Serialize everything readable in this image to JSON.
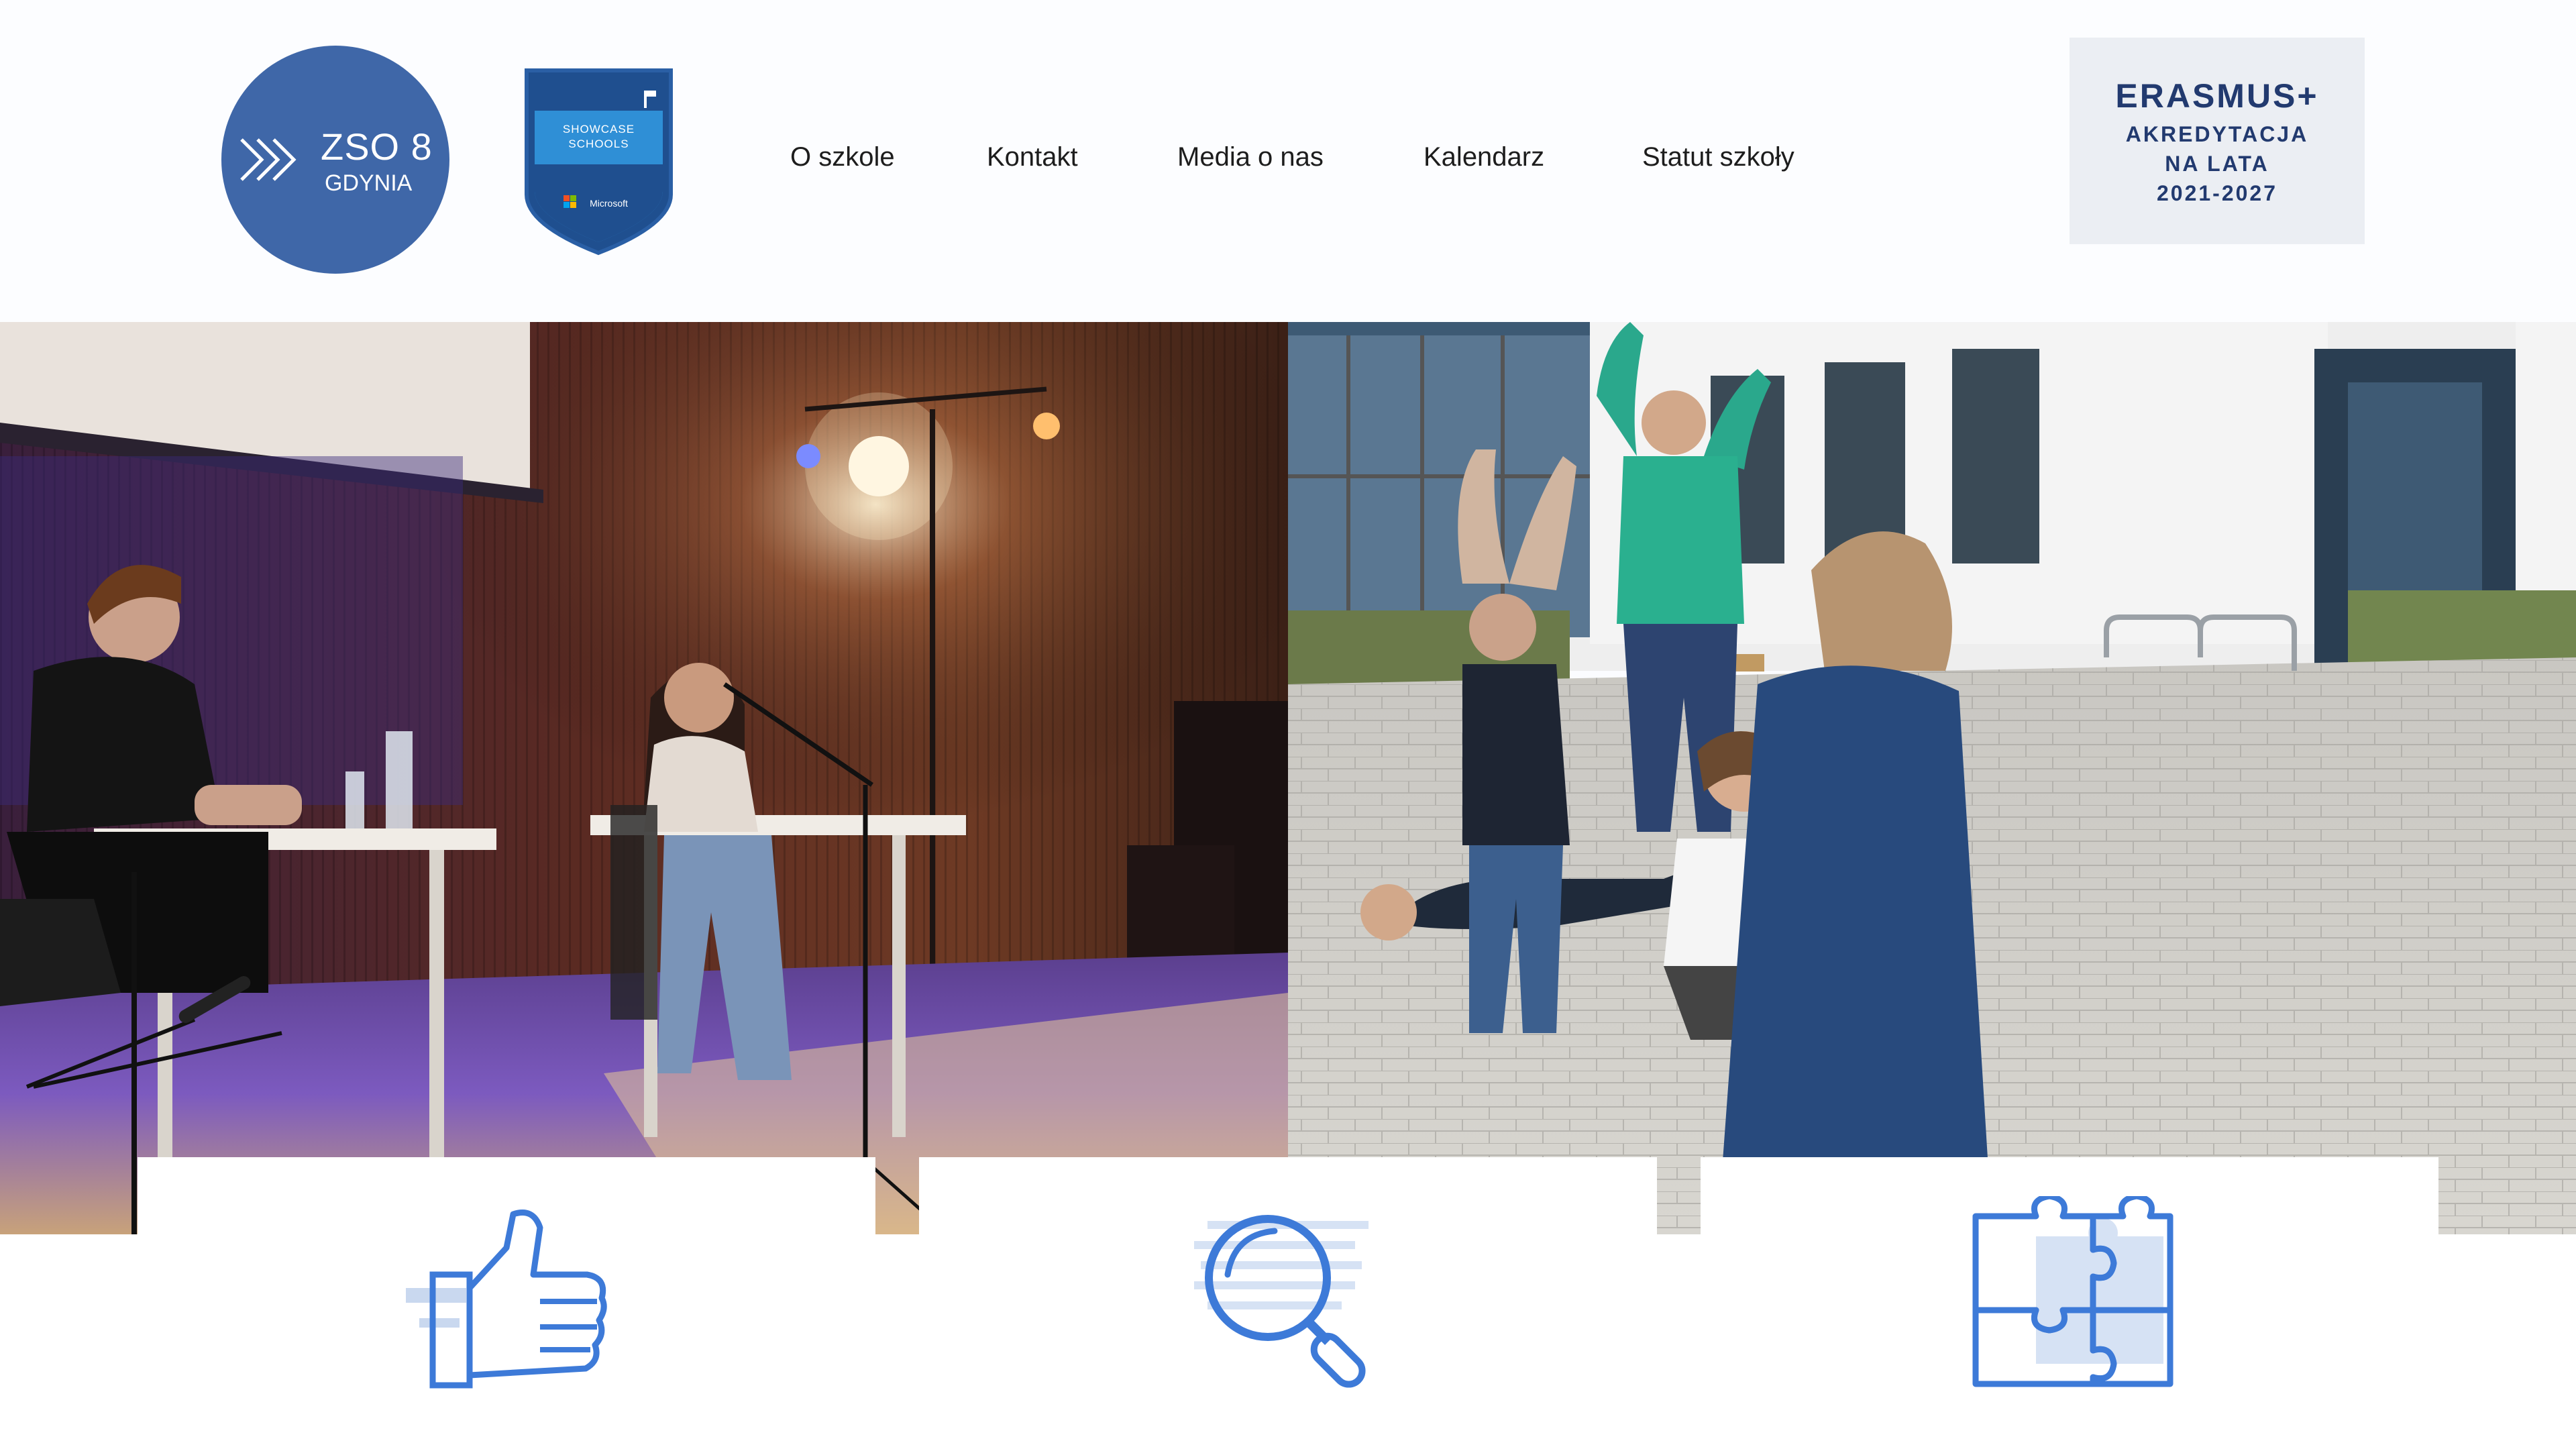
{
  "header": {
    "logo": {
      "line1": "ZSO 8",
      "line2": "GDYNIA"
    },
    "badge": {
      "line1": "SHOWCASE",
      "line2": "SCHOOLS",
      "brand": "Microsoft"
    },
    "nav": [
      {
        "label": "O szkole"
      },
      {
        "label": "Kontakt"
      },
      {
        "label": "Media o nas"
      },
      {
        "label": "Kalendarz"
      },
      {
        "label": "Statut szkoły"
      }
    ],
    "erasmus": {
      "line1": "ERASMUS+",
      "line2": "AKREDYTACJA",
      "line3": "NA LATA",
      "line4": "2021-2027"
    }
  },
  "features": [
    {
      "icon": "thumbs-up-icon"
    },
    {
      "icon": "magnifier-icon"
    },
    {
      "icon": "puzzle-icon"
    }
  ],
  "colors": {
    "brand_blue": "#3f67a8",
    "icon_blue": "#3d7ad8",
    "erasmus_navy": "#223a6f"
  }
}
